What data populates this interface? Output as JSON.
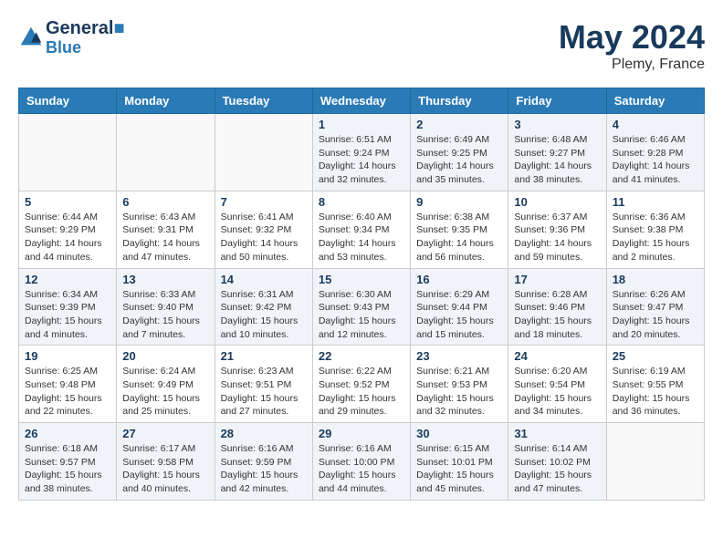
{
  "header": {
    "logo_line1": "General",
    "logo_line2": "Blue",
    "month_title": "May 2024",
    "location": "Plemy, France"
  },
  "days_of_week": [
    "Sunday",
    "Monday",
    "Tuesday",
    "Wednesday",
    "Thursday",
    "Friday",
    "Saturday"
  ],
  "weeks": [
    [
      {
        "day": "",
        "info": ""
      },
      {
        "day": "",
        "info": ""
      },
      {
        "day": "",
        "info": ""
      },
      {
        "day": "1",
        "info": "Sunrise: 6:51 AM\nSunset: 9:24 PM\nDaylight: 14 hours\nand 32 minutes."
      },
      {
        "day": "2",
        "info": "Sunrise: 6:49 AM\nSunset: 9:25 PM\nDaylight: 14 hours\nand 35 minutes."
      },
      {
        "day": "3",
        "info": "Sunrise: 6:48 AM\nSunset: 9:27 PM\nDaylight: 14 hours\nand 38 minutes."
      },
      {
        "day": "4",
        "info": "Sunrise: 6:46 AM\nSunset: 9:28 PM\nDaylight: 14 hours\nand 41 minutes."
      }
    ],
    [
      {
        "day": "5",
        "info": "Sunrise: 6:44 AM\nSunset: 9:29 PM\nDaylight: 14 hours\nand 44 minutes."
      },
      {
        "day": "6",
        "info": "Sunrise: 6:43 AM\nSunset: 9:31 PM\nDaylight: 14 hours\nand 47 minutes."
      },
      {
        "day": "7",
        "info": "Sunrise: 6:41 AM\nSunset: 9:32 PM\nDaylight: 14 hours\nand 50 minutes."
      },
      {
        "day": "8",
        "info": "Sunrise: 6:40 AM\nSunset: 9:34 PM\nDaylight: 14 hours\nand 53 minutes."
      },
      {
        "day": "9",
        "info": "Sunrise: 6:38 AM\nSunset: 9:35 PM\nDaylight: 14 hours\nand 56 minutes."
      },
      {
        "day": "10",
        "info": "Sunrise: 6:37 AM\nSunset: 9:36 PM\nDaylight: 14 hours\nand 59 minutes."
      },
      {
        "day": "11",
        "info": "Sunrise: 6:36 AM\nSunset: 9:38 PM\nDaylight: 15 hours\nand 2 minutes."
      }
    ],
    [
      {
        "day": "12",
        "info": "Sunrise: 6:34 AM\nSunset: 9:39 PM\nDaylight: 15 hours\nand 4 minutes."
      },
      {
        "day": "13",
        "info": "Sunrise: 6:33 AM\nSunset: 9:40 PM\nDaylight: 15 hours\nand 7 minutes."
      },
      {
        "day": "14",
        "info": "Sunrise: 6:31 AM\nSunset: 9:42 PM\nDaylight: 15 hours\nand 10 minutes."
      },
      {
        "day": "15",
        "info": "Sunrise: 6:30 AM\nSunset: 9:43 PM\nDaylight: 15 hours\nand 12 minutes."
      },
      {
        "day": "16",
        "info": "Sunrise: 6:29 AM\nSunset: 9:44 PM\nDaylight: 15 hours\nand 15 minutes."
      },
      {
        "day": "17",
        "info": "Sunrise: 6:28 AM\nSunset: 9:46 PM\nDaylight: 15 hours\nand 18 minutes."
      },
      {
        "day": "18",
        "info": "Sunrise: 6:26 AM\nSunset: 9:47 PM\nDaylight: 15 hours\nand 20 minutes."
      }
    ],
    [
      {
        "day": "19",
        "info": "Sunrise: 6:25 AM\nSunset: 9:48 PM\nDaylight: 15 hours\nand 22 minutes."
      },
      {
        "day": "20",
        "info": "Sunrise: 6:24 AM\nSunset: 9:49 PM\nDaylight: 15 hours\nand 25 minutes."
      },
      {
        "day": "21",
        "info": "Sunrise: 6:23 AM\nSunset: 9:51 PM\nDaylight: 15 hours\nand 27 minutes."
      },
      {
        "day": "22",
        "info": "Sunrise: 6:22 AM\nSunset: 9:52 PM\nDaylight: 15 hours\nand 29 minutes."
      },
      {
        "day": "23",
        "info": "Sunrise: 6:21 AM\nSunset: 9:53 PM\nDaylight: 15 hours\nand 32 minutes."
      },
      {
        "day": "24",
        "info": "Sunrise: 6:20 AM\nSunset: 9:54 PM\nDaylight: 15 hours\nand 34 minutes."
      },
      {
        "day": "25",
        "info": "Sunrise: 6:19 AM\nSunset: 9:55 PM\nDaylight: 15 hours\nand 36 minutes."
      }
    ],
    [
      {
        "day": "26",
        "info": "Sunrise: 6:18 AM\nSunset: 9:57 PM\nDaylight: 15 hours\nand 38 minutes."
      },
      {
        "day": "27",
        "info": "Sunrise: 6:17 AM\nSunset: 9:58 PM\nDaylight: 15 hours\nand 40 minutes."
      },
      {
        "day": "28",
        "info": "Sunrise: 6:16 AM\nSunset: 9:59 PM\nDaylight: 15 hours\nand 42 minutes."
      },
      {
        "day": "29",
        "info": "Sunrise: 6:16 AM\nSunset: 10:00 PM\nDaylight: 15 hours\nand 44 minutes."
      },
      {
        "day": "30",
        "info": "Sunrise: 6:15 AM\nSunset: 10:01 PM\nDaylight: 15 hours\nand 45 minutes."
      },
      {
        "day": "31",
        "info": "Sunrise: 6:14 AM\nSunset: 10:02 PM\nDaylight: 15 hours\nand 47 minutes."
      },
      {
        "day": "",
        "info": ""
      }
    ]
  ]
}
